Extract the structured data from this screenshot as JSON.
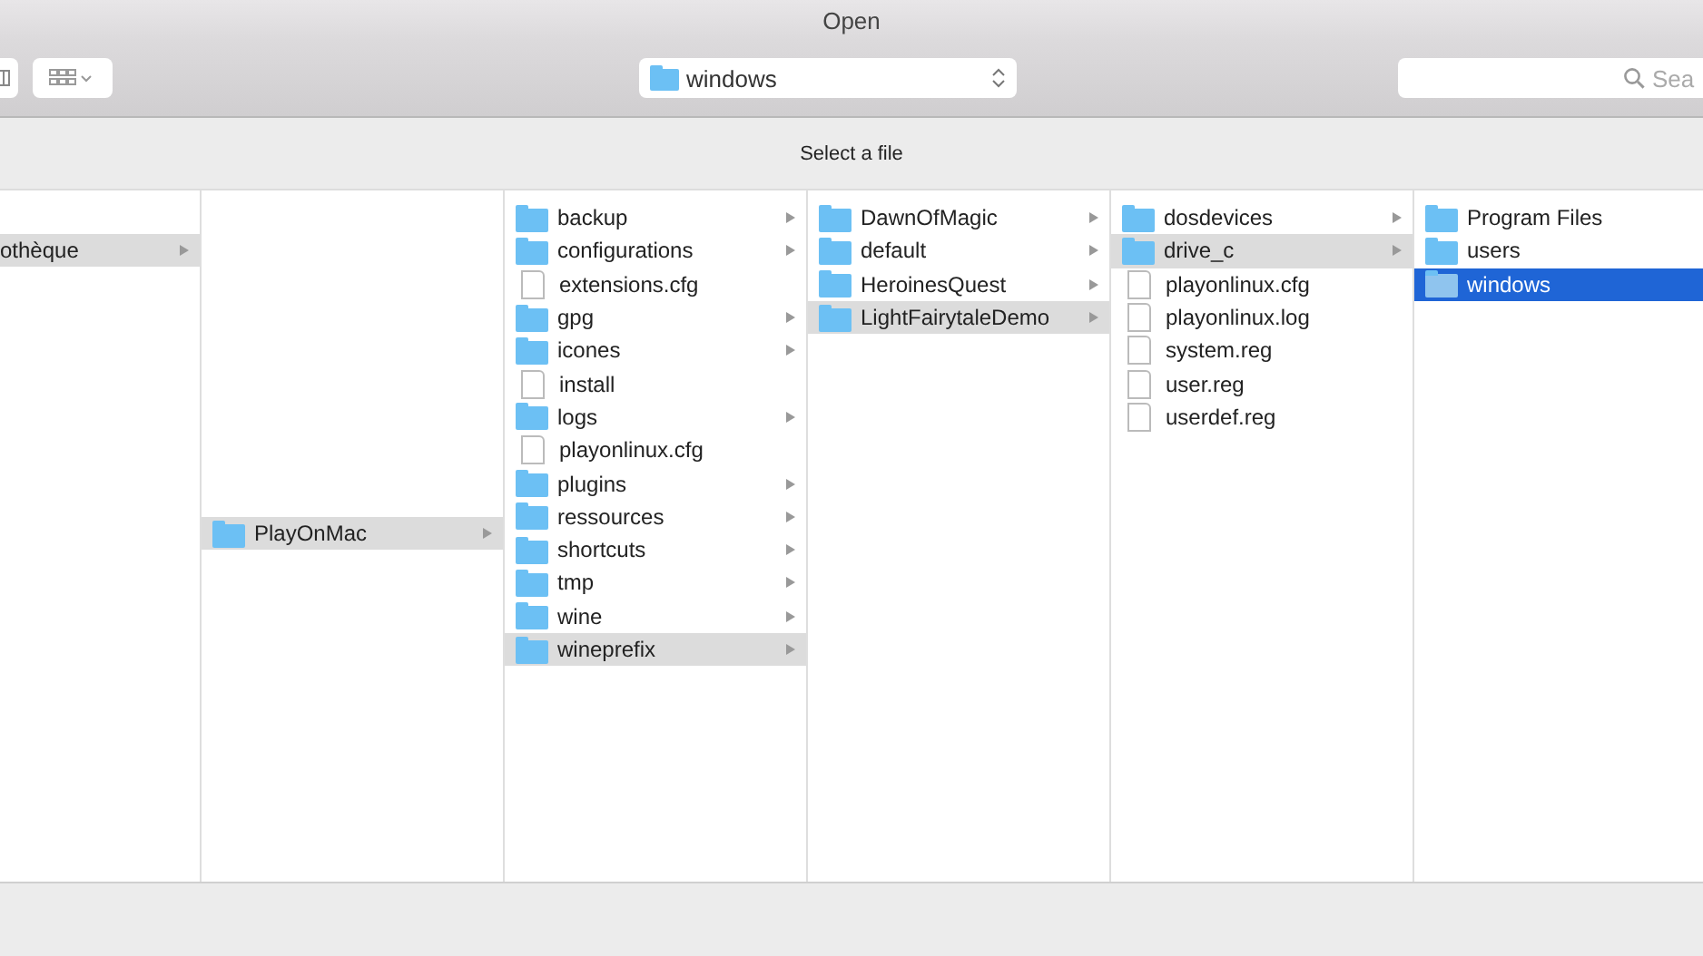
{
  "window": {
    "title": "Open"
  },
  "toolbar": {
    "location": "windows",
    "search": {
      "placeholder": "Sea"
    }
  },
  "prompt": "Select a file",
  "columns": [
    {
      "active": false,
      "items": [
        {
          "name": "othèque",
          "kind": "folder",
          "selected": true
        }
      ]
    },
    {
      "active": false,
      "items": [
        {
          "name": "PlayOnMac",
          "kind": "folder",
          "selected": true
        }
      ]
    },
    {
      "active": false,
      "items": [
        {
          "name": "backup",
          "kind": "folder",
          "selected": false
        },
        {
          "name": "configurations",
          "kind": "folder",
          "selected": false
        },
        {
          "name": "extensions.cfg",
          "kind": "file",
          "selected": false
        },
        {
          "name": "gpg",
          "kind": "folder",
          "selected": false
        },
        {
          "name": "icones",
          "kind": "folder",
          "selected": false
        },
        {
          "name": "install",
          "kind": "file",
          "selected": false
        },
        {
          "name": "logs",
          "kind": "folder",
          "selected": false
        },
        {
          "name": "playonlinux.cfg",
          "kind": "file",
          "selected": false
        },
        {
          "name": "plugins",
          "kind": "folder",
          "selected": false
        },
        {
          "name": "ressources",
          "kind": "folder",
          "selected": false
        },
        {
          "name": "shortcuts",
          "kind": "folder",
          "selected": false
        },
        {
          "name": "tmp",
          "kind": "folder",
          "selected": false
        },
        {
          "name": "wine",
          "kind": "folder",
          "selected": false
        },
        {
          "name": "wineprefix",
          "kind": "folder",
          "selected": true
        }
      ]
    },
    {
      "active": false,
      "items": [
        {
          "name": "DawnOfMagic",
          "kind": "folder",
          "selected": false
        },
        {
          "name": "default",
          "kind": "folder",
          "selected": false
        },
        {
          "name": "HeroinesQuest",
          "kind": "folder",
          "selected": false
        },
        {
          "name": "LightFairytaleDemo",
          "kind": "folder",
          "selected": true
        }
      ]
    },
    {
      "active": false,
      "items": [
        {
          "name": "dosdevices",
          "kind": "folder",
          "selected": false
        },
        {
          "name": "drive_c",
          "kind": "folder",
          "selected": true
        },
        {
          "name": "playonlinux.cfg",
          "kind": "file",
          "selected": false
        },
        {
          "name": "playonlinux.log",
          "kind": "file",
          "selected": false
        },
        {
          "name": "system.reg",
          "kind": "file",
          "selected": false
        },
        {
          "name": "user.reg",
          "kind": "file",
          "selected": false
        },
        {
          "name": "userdef.reg",
          "kind": "file",
          "selected": false
        }
      ]
    },
    {
      "active": true,
      "items": [
        {
          "name": "Program Files",
          "kind": "folder",
          "selected": false
        },
        {
          "name": "users",
          "kind": "folder",
          "selected": false
        },
        {
          "name": "windows",
          "kind": "folder",
          "selected": true
        }
      ]
    }
  ]
}
